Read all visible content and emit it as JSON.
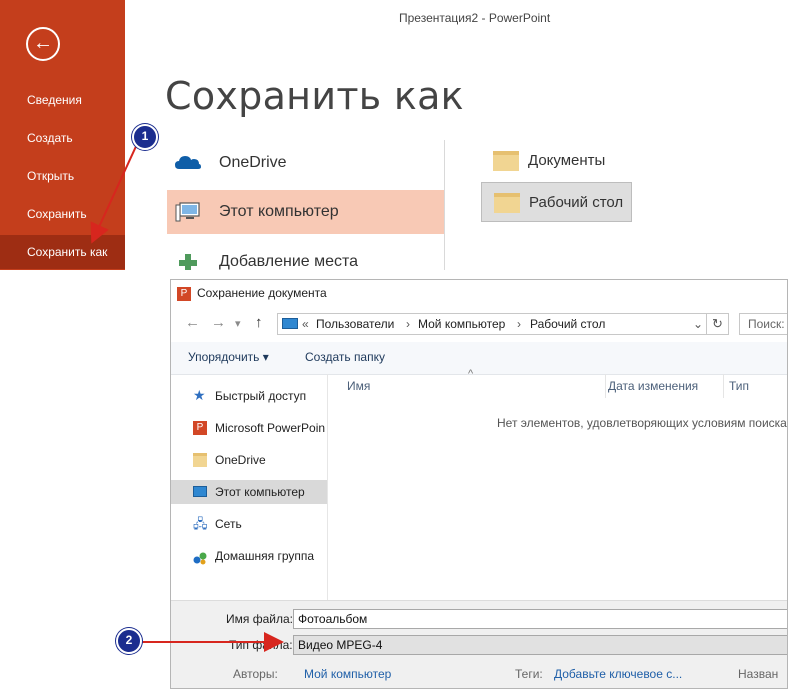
{
  "powerpoint": {
    "window_title": "Презентация2 - PowerPoint",
    "heading": "Сохранить как",
    "back_icon": "←",
    "sidebar": [
      {
        "label": "Сведения"
      },
      {
        "label": "Создать"
      },
      {
        "label": "Открыть"
      },
      {
        "label": "Сохранить"
      },
      {
        "label": "Сохранить как",
        "selected": true
      }
    ],
    "locations": [
      {
        "label": "OneDrive",
        "icon": "cloud-icon"
      },
      {
        "label": "Этот компьютер",
        "icon": "computer-icon",
        "selected": true
      },
      {
        "label": "Добавление места",
        "icon": "plus-icon"
      }
    ],
    "folders": [
      {
        "label": "Документы"
      },
      {
        "label": "Рабочий стол",
        "selected": true
      }
    ],
    "accent_color": "#c43e1c"
  },
  "dialog": {
    "title": "Сохранение документа",
    "breadcrumb": {
      "prefix": "«",
      "items": [
        "Пользователи",
        "Мой компьютер",
        "Рабочий стол"
      ]
    },
    "search_placeholder": "Поиск:",
    "toolbar": {
      "organize": "Упорядочить ▾",
      "new_folder": "Создать папку"
    },
    "nav_items": [
      {
        "label": "Быстрый доступ",
        "icon": "star-icon"
      },
      {
        "label": "Microsoft PowerPoin",
        "icon": "powerpoint-icon"
      },
      {
        "label": "OneDrive",
        "icon": "folder-icon"
      },
      {
        "label": "Этот компьютер",
        "icon": "computer-icon",
        "selected": true
      },
      {
        "label": "Сеть",
        "icon": "network-icon"
      },
      {
        "label": "Домашняя группа",
        "icon": "homegroup-icon"
      }
    ],
    "columns": [
      "Имя",
      "Дата изменения",
      "Тип"
    ],
    "empty_message": "Нет элементов, удовлетворяющих условиям поиска.",
    "filename_label": "Имя файла:",
    "filename_value": "Фотоальбом",
    "filetype_label": "Тип файла:",
    "filetype_value": "Видео MPEG-4",
    "authors_label": "Авторы:",
    "authors_value": "Мой компьютер",
    "tags_label": "Теги:",
    "tags_value": "Добавьте ключевое с...",
    "title_label": "Назван"
  },
  "callouts": [
    "1",
    "2"
  ]
}
